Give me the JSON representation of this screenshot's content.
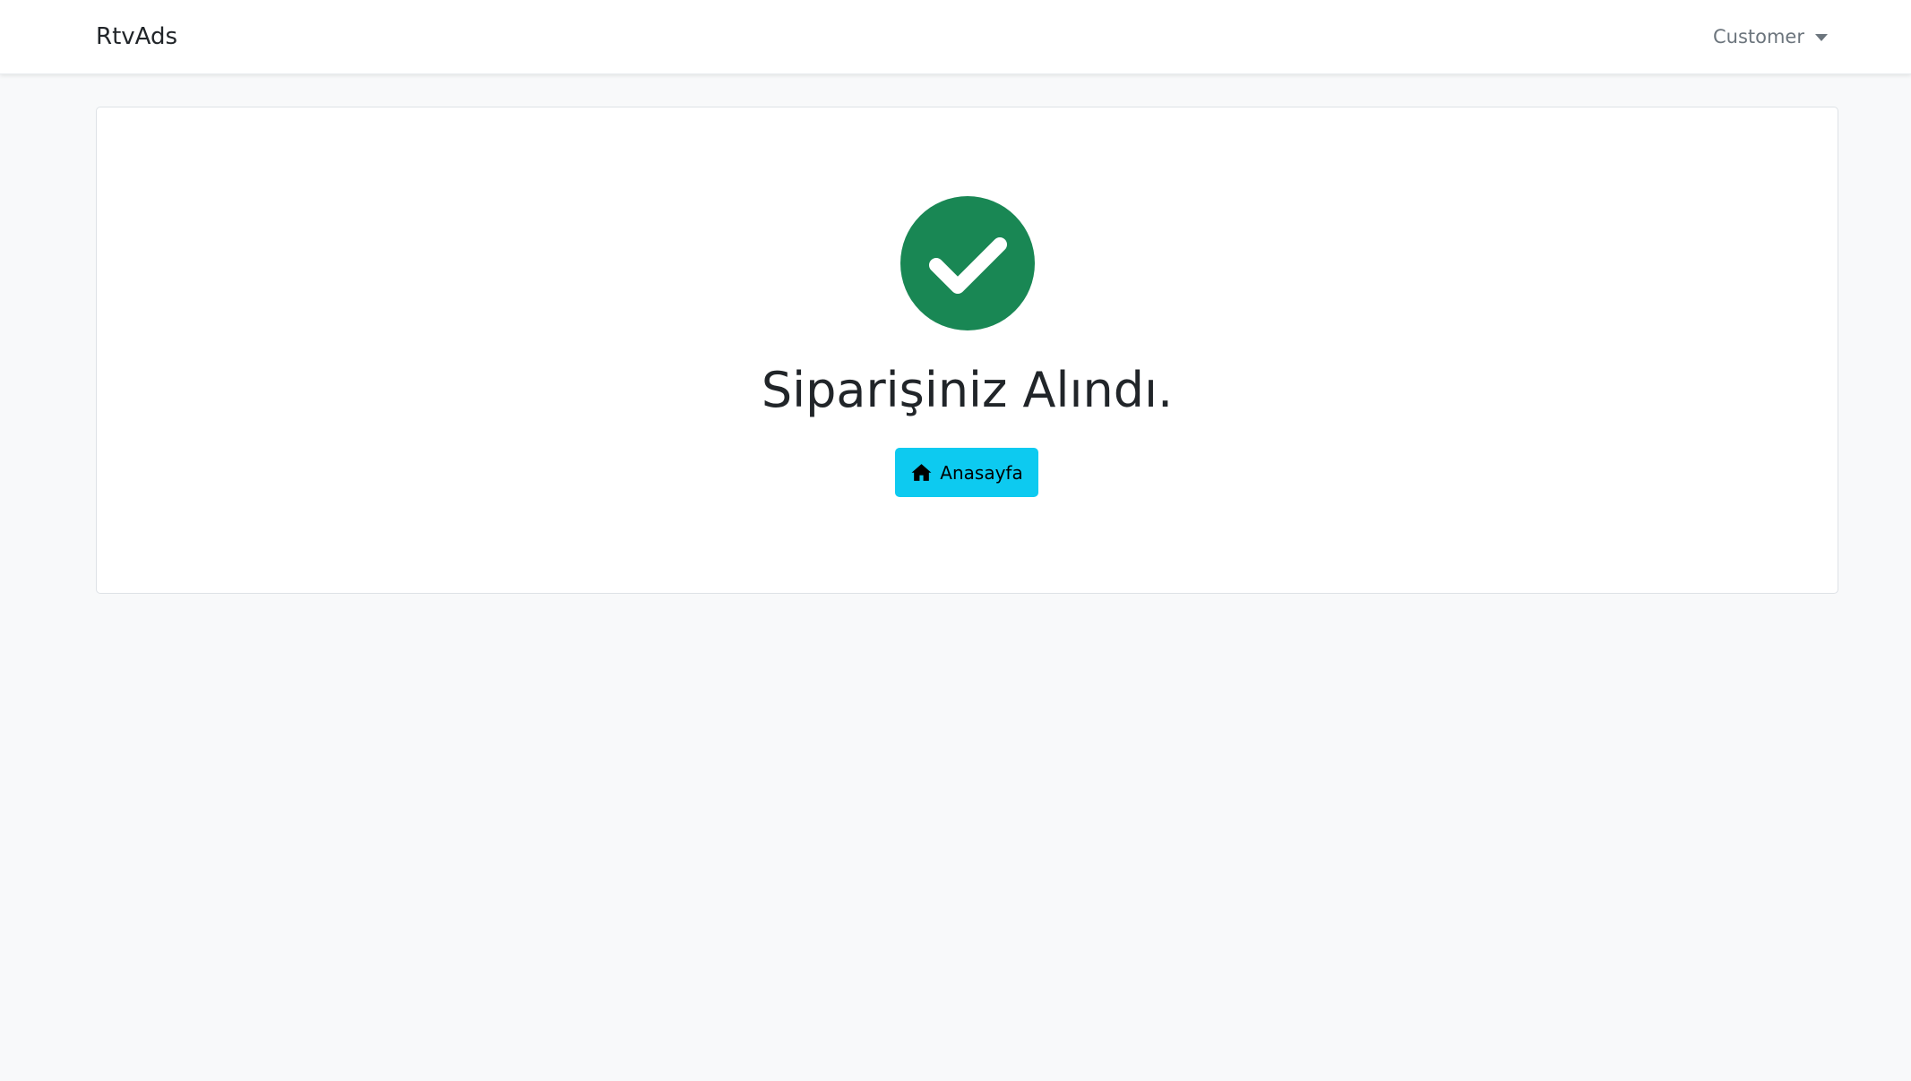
{
  "navbar": {
    "brand": "RtvAds",
    "user_menu_label": "Customer"
  },
  "main": {
    "success_icon": "check-circle-icon",
    "title": "Siparişiniz Alındı.",
    "home_button": {
      "icon": "home-icon",
      "label": "Anasayfa"
    }
  },
  "colors": {
    "success_green": "#198754",
    "button_cyan": "#0dcaf0",
    "page_background": "#f8f9fa"
  }
}
